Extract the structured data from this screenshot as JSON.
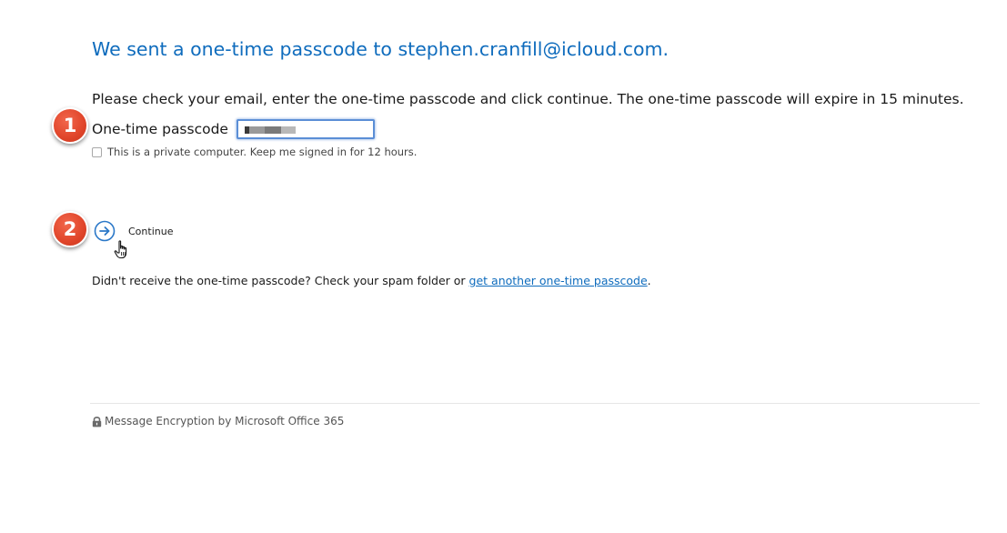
{
  "header": {
    "title": "We sent a one-time passcode to stephen.cranfill@icloud.com."
  },
  "instructions": "Please check your email, enter the one-time passcode and click continue. The one-time passcode will expire in 15 minutes.",
  "passcode": {
    "label": "One-time passcode",
    "value": ""
  },
  "remember": {
    "label": "This is a private computer. Keep me signed in for 12 hours.",
    "checked": false
  },
  "annotations": {
    "step_1": "1",
    "step_2": "2",
    "badge_color": "#e0452a"
  },
  "continue": {
    "label": "Continue",
    "icon": "arrow-right-circle-icon"
  },
  "resend": {
    "prefix": "Didn't receive the one-time passcode? Check your spam folder or ",
    "link_label": "get another one-time passcode",
    "suffix": "."
  },
  "footer": {
    "icon": "lock-icon",
    "text": "Message Encryption by Microsoft Office 365"
  },
  "colors": {
    "accent": "#0f6cbd",
    "input_focus": "#5b8ed6"
  }
}
